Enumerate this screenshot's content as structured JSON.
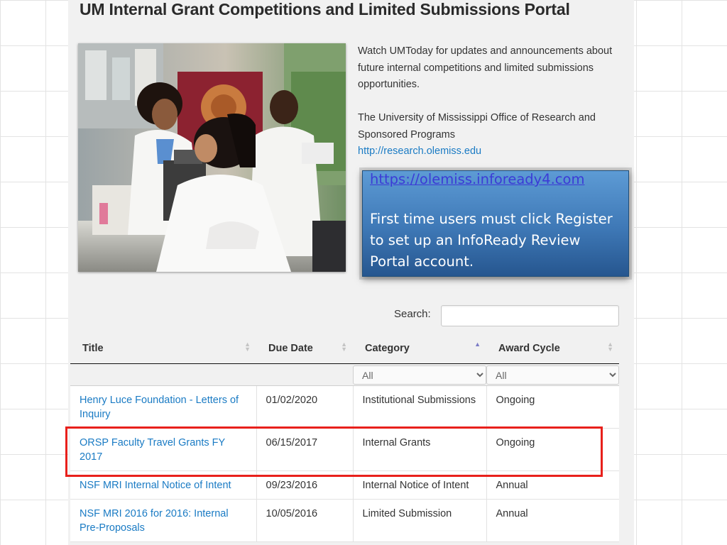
{
  "page": {
    "title": "UM Internal Grant Competitions and Limited Submissions Portal"
  },
  "intro": {
    "paragraph1": "Watch UMToday for updates and announcements about future internal competitions and limited submissions opportunities.",
    "paragraph2": "The University of Mississippi Office of Research and Sponsored Programs",
    "link": "http://research.olemiss.edu"
  },
  "callout": {
    "link": "https://olemiss.infoready4.com",
    "message": "First time users must click Register to set up an InfoReady Review Portal account."
  },
  "search": {
    "label": "Search:",
    "value": "",
    "placeholder": ""
  },
  "table": {
    "columns": [
      "Title",
      "Due Date",
      "Category",
      "Award Cycle"
    ],
    "filters": {
      "category": "All",
      "award_cycle": "All"
    },
    "rows": [
      {
        "title": "Henry Luce Foundation - Letters of Inquiry",
        "due_date": "01/02/2020",
        "category": "Institutional Submissions",
        "award_cycle": "Ongoing"
      },
      {
        "title": "ORSP Faculty Travel Grants FY 2017",
        "due_date": "06/15/2017",
        "category": "Internal Grants",
        "award_cycle": "Ongoing"
      },
      {
        "title": "NSF MRI Internal Notice of Intent",
        "due_date": "09/23/2016",
        "category": "Internal Notice of Intent",
        "award_cycle": "Annual"
      },
      {
        "title": "NSF MRI 2016 for 2016: Internal Pre-Proposals",
        "due_date": "10/05/2016",
        "category": "Limited Submission",
        "award_cycle": "Annual"
      }
    ],
    "sort": {
      "column": "Category",
      "direction": "ascending"
    }
  },
  "colors": {
    "link": "#1a7bc4",
    "callout_top": "#5d9bd5",
    "callout_bottom": "#26568f",
    "highlight": "#e8201b",
    "panel_bg": "#f1f1f1"
  },
  "icons": [
    "sort-arrows-icon",
    "sort-ascending-icon",
    "select-arrows-icon"
  ]
}
